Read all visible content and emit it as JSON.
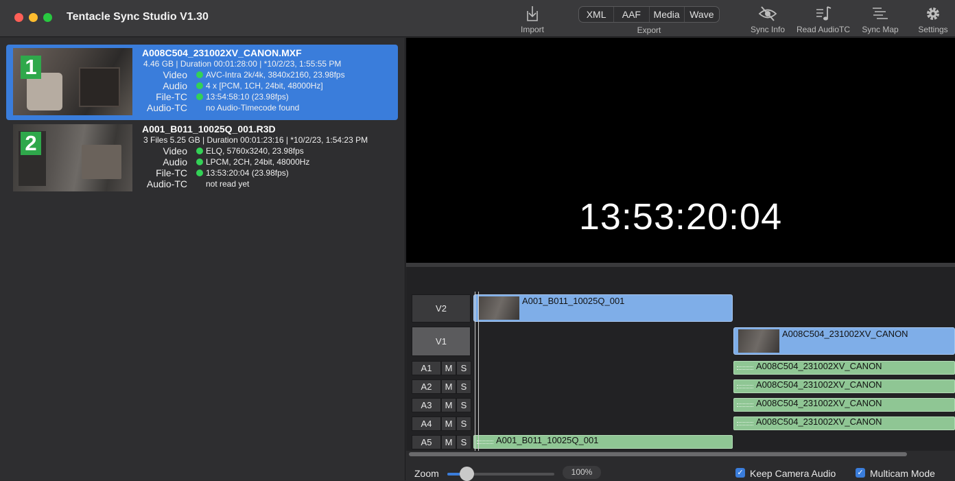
{
  "app": {
    "title": "Tentacle Sync Studio V1.30"
  },
  "toolbar": {
    "import_label": "Import",
    "export_label": "Export",
    "export_options": [
      "XML",
      "AAF",
      "Media",
      "Wave"
    ],
    "sync_info_label": "Sync Info",
    "read_audio_tc_label": "Read AudioTC",
    "sync_map_label": "Sync Map",
    "settings_label": "Settings"
  },
  "clips": [
    {
      "number": "1",
      "name": "A008C504_231002XV_CANON.MXF",
      "meta": "4.46 GB | Duration 00:01:28:00 | *10/2/23, 1:55:55 PM",
      "video_label": "Video",
      "video": "AVC-Intra 2k/4k, 3840x2160, 23.98fps",
      "audio_label": "Audio",
      "audio": "4 x [PCM, 1CH, 24bit, 48000Hz]",
      "filetc_label": "File-TC",
      "filetc": "13:54:58:10 (23.98fps)",
      "audiotc_label": "Audio-TC",
      "audiotc": "no Audio-Timecode found",
      "selected": true
    },
    {
      "number": "2",
      "name": "A001_B011_10025Q_001.R3D",
      "meta": "3 Files 5.25 GB | Duration 00:01:23:16 | *10/2/23, 1:54:23 PM",
      "video_label": "Video",
      "video": "ELQ, 5760x3240, 23.98fps",
      "audio_label": "Audio",
      "audio": "LPCM, 2CH, 24bit, 48000Hz",
      "filetc_label": "File-TC",
      "filetc": "13:53:20:04 (23.98fps)",
      "audiotc_label": "Audio-TC",
      "audiotc": "not read yet",
      "selected": false
    }
  ],
  "preview": {
    "timecode": "13:53:20:04"
  },
  "timeline": {
    "tracks": {
      "v2": "V2",
      "v1": "V1",
      "audio": [
        {
          "name": "A1",
          "mute": "M",
          "solo": "S"
        },
        {
          "name": "A2",
          "mute": "M",
          "solo": "S"
        },
        {
          "name": "A3",
          "mute": "M",
          "solo": "S"
        },
        {
          "name": "A4",
          "mute": "M",
          "solo": "S"
        },
        {
          "name": "A5",
          "mute": "M",
          "solo": "S"
        }
      ]
    },
    "clips": {
      "v2": "A001_B011_10025Q_001",
      "v1": "A008C504_231002XV_CANON",
      "a1": "A008C504_231002XV_CANON",
      "a2": "A008C504_231002XV_CANON",
      "a3": "A008C504_231002XV_CANON",
      "a4": "A008C504_231002XV_CANON",
      "a5": "A001_B011_10025Q_001"
    }
  },
  "bottom": {
    "zoom_label": "Zoom",
    "zoom_value": "100%",
    "keep_camera_audio": "Keep Camera Audio",
    "multicam_mode": "Multicam Mode"
  },
  "colors": {
    "accent": "#3a7ddb",
    "status_ok": "#33d156",
    "video_clip": "#7faee8",
    "audio_clip": "#8fc694"
  }
}
